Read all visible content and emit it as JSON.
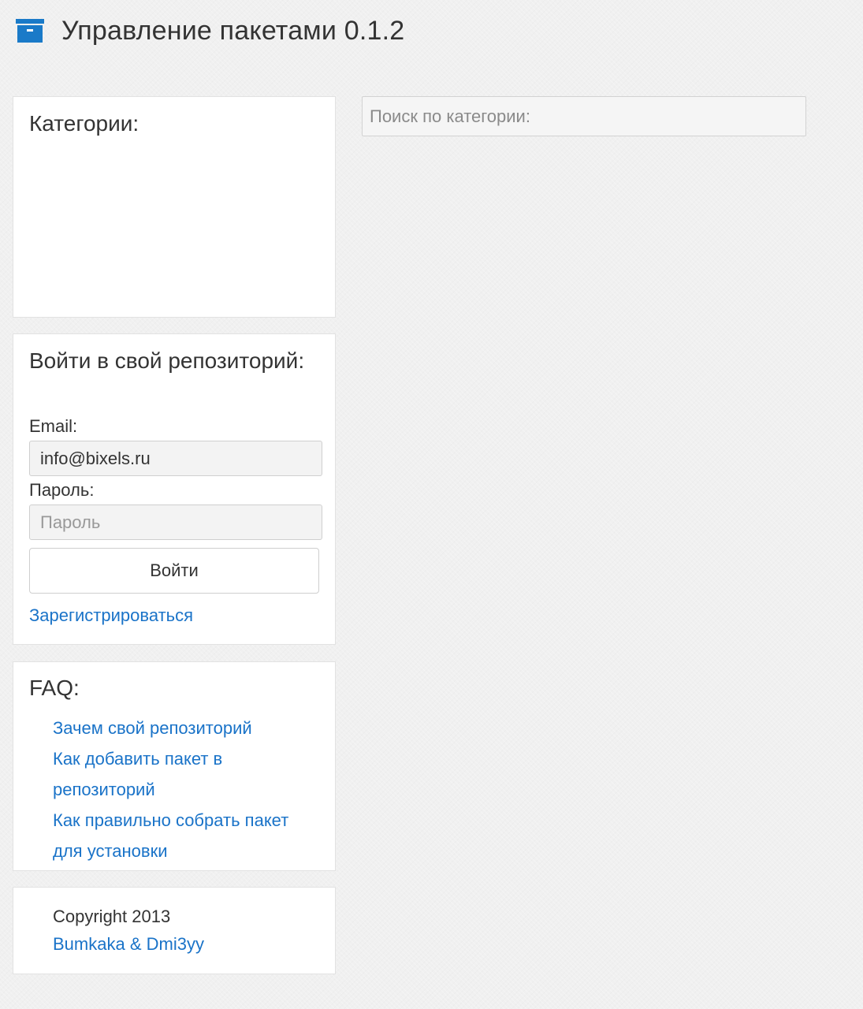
{
  "header": {
    "icon": "archive-box-icon",
    "icon_color": "#1a7ac8",
    "title": "Управление пакетами 0.1.2"
  },
  "categories": {
    "title": "Категории:"
  },
  "search": {
    "placeholder": "Поиск по категории:",
    "value": ""
  },
  "login": {
    "title": "Войти в свой репозиторий:",
    "email_label": "Email:",
    "email_value": "info@bixels.ru",
    "password_label": "Пароль:",
    "password_placeholder": "Пароль",
    "submit_label": "Войти",
    "register_link": "Зарегистрироваться"
  },
  "faq": {
    "title": "FAQ:",
    "items": [
      "Зачем свой репозиторий",
      "Как добавить пакет в репозиторий",
      "Как правильно собрать пакет для установки"
    ]
  },
  "footer": {
    "copyright": "Copyright 2013",
    "authors_link": "Bumkaka & Dmi3yy"
  },
  "colors": {
    "link": "#1a73c8",
    "background": "#f0f0f0"
  }
}
